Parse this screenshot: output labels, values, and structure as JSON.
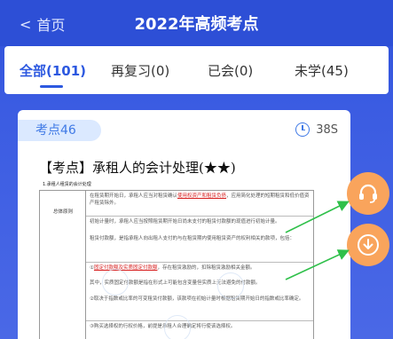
{
  "header": {
    "back_label": "首页",
    "title": "2022年高频考点"
  },
  "tabs": [
    {
      "label": "全部(101)",
      "active": true
    },
    {
      "label": "再复习(0)",
      "active": false
    },
    {
      "label": "已会(0)",
      "active": false
    },
    {
      "label": "未学(45)",
      "active": false
    }
  ],
  "card": {
    "tag": "考点46",
    "timer": "38S",
    "heading": "【考点】承租人的会计处理(★★)",
    "doc_title": "1.承租人租赁的会计处理",
    "table_left": {
      "row1": "总体原则"
    },
    "table_rows": [
      {
        "text_a": "在租赁期开始日，承租人应当对租赁确认",
        "hl": "使用权资产和租赁负债",
        "text_b": "，应用简化处理的短期租赁和低价值资产租赁除外。"
      },
      {
        "text_a": "初始计量时，承租人应当按照租赁期开始日尚未支付的租赁付款额的现值进行初始计量。",
        "hl": "",
        "text_b": ""
      },
      {
        "text_a": "租赁付款额，是指承租人向出租人支付的与在租赁期内使用租赁资产的权利相关的款项，包括：",
        "hl": "",
        "text_b": ""
      },
      {
        "text_a": "①",
        "hl": "固定付款额及实质固定付款额",
        "text_b": "，存在租赁激励的，扣除租赁激励相关金额。"
      },
      {
        "text_a": "其中，实质固定付款额是指在形式上可能包含变量但实质上无法避免的付款额。",
        "hl": "",
        "text_b": ""
      },
      {
        "text_a": "②取决于指数或比率的可变租赁付款额，该款项在初始计量时根据租赁期开始日的指数或比率确定。",
        "hl": "",
        "text_b": ""
      },
      {
        "text_a": "③购买选择权的行权价格，前提是承租人合理确定将行使该选择权。",
        "hl": "",
        "text_b": ""
      }
    ]
  },
  "float_buttons": {
    "support": "headset-icon",
    "download": "download-icon"
  },
  "colors": {
    "header_bg": "#2d4fd6",
    "accent": "#2d59e0",
    "tag_text": "#3f79e6",
    "float_btn": "#f9a45c",
    "arrow": "#2fc04a"
  }
}
